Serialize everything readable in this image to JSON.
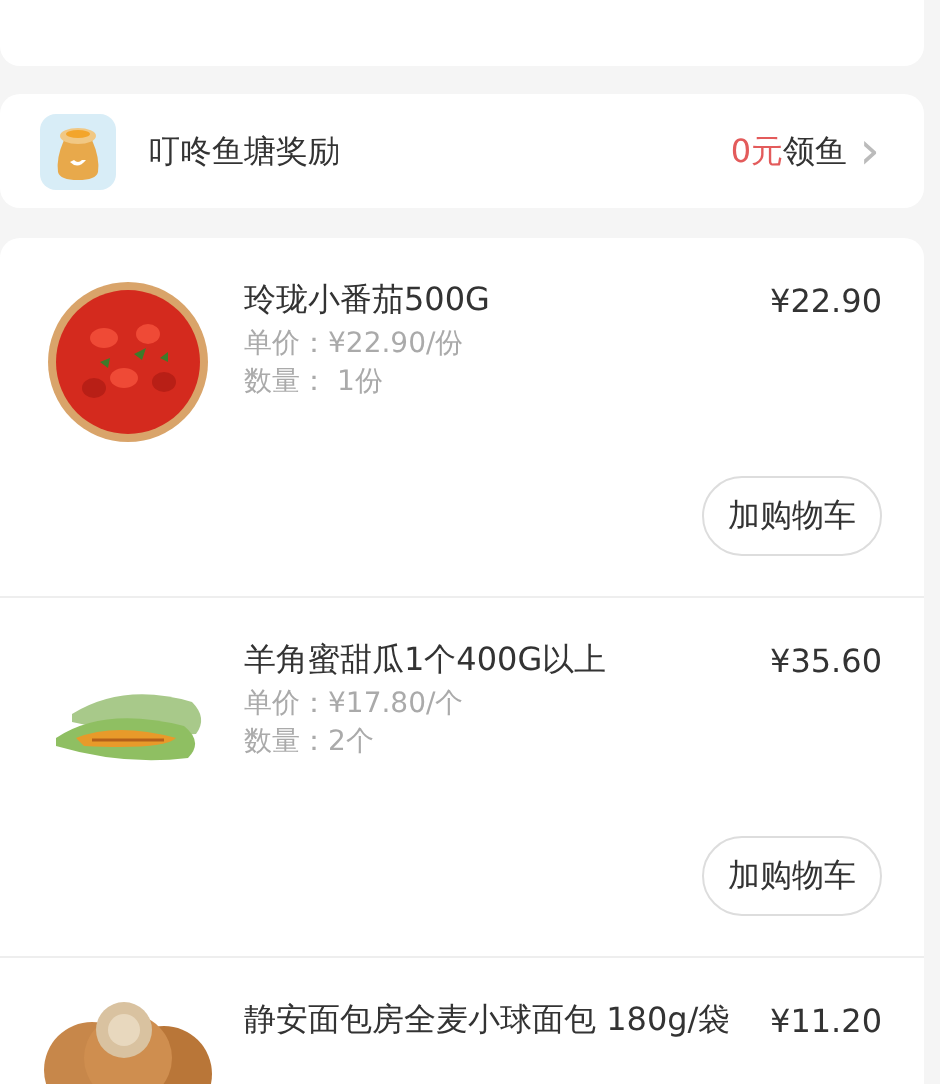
{
  "reward": {
    "title": "叮咚鱼塘奖励",
    "amount": "0元",
    "action": "领鱼",
    "chevron": "›"
  },
  "products": [
    {
      "name": "玲珑小番茄500G",
      "price": "¥22.90",
      "unit_price": "单价：¥22.90/份",
      "quantity": "数量： 1份",
      "button": "加购物车",
      "kind": "tomato"
    },
    {
      "name": "羊角蜜甜瓜1个400G以上",
      "price": "¥35.60",
      "unit_price": "单价：¥17.80/个",
      "quantity": "数量：2个",
      "button": "加购物车",
      "kind": "melon"
    },
    {
      "name": "静安面包房全麦小球面包 180g/袋",
      "price": "¥11.20",
      "kind": "bread"
    }
  ]
}
